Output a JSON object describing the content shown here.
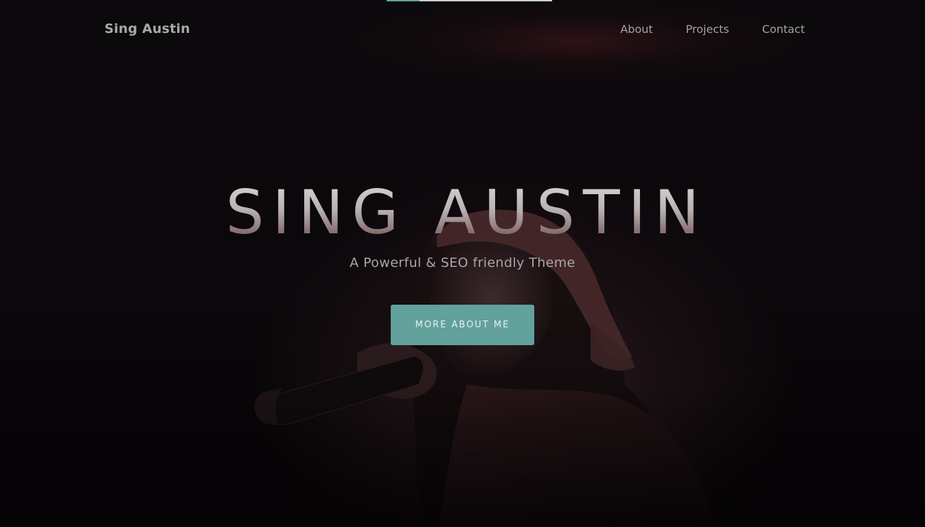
{
  "header": {
    "brand": "Sing Austin",
    "nav": [
      {
        "label": "About"
      },
      {
        "label": "Projects"
      },
      {
        "label": "Contact"
      }
    ]
  },
  "hero": {
    "title": "SING AUSTIN",
    "subtitle": "A Powerful & SEO friendly Theme",
    "cta_label": "MORE ABOUT ME",
    "image": "singer-with-microphone-photo"
  },
  "colors": {
    "accent": "#62a19c",
    "background": "#0a070a",
    "nav_text": "#a3a3a3"
  }
}
